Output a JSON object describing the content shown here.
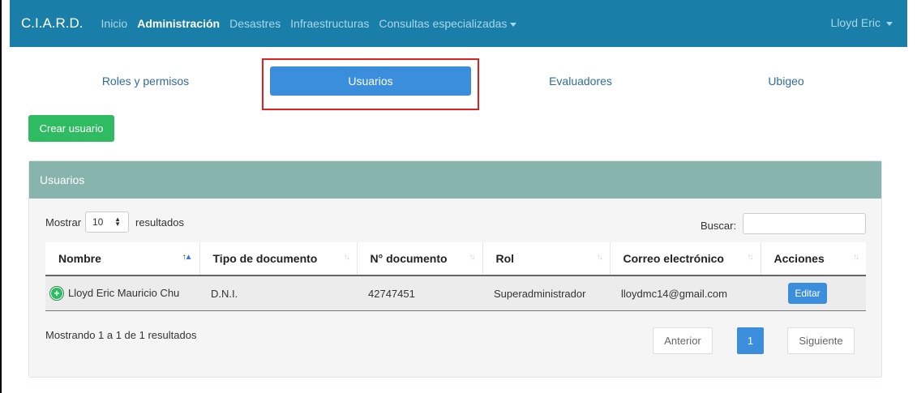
{
  "navbar": {
    "brand": "C.I.A.R.D.",
    "links": [
      "Inicio",
      "Administración",
      "Desastres",
      "Infraestructuras",
      "Consultas especializadas"
    ],
    "user": "Lloyd Eric"
  },
  "tabs": [
    "Roles y permisos",
    "Usuarios",
    "Evaluadores",
    "Ubigeo"
  ],
  "create_button": "Crear usuario",
  "panel": {
    "title": "Usuarios",
    "show_label": "Mostrar",
    "show_value": "10",
    "results_label": "resultados",
    "search_label": "Buscar:"
  },
  "table": {
    "headers": [
      "Nombre",
      "Tipo de documento",
      "N° documento",
      "Rol",
      "Correo electrónico",
      "Acciones"
    ],
    "rows": [
      {
        "nombre": "Lloyd Eric Mauricio Chu",
        "tipo_documento": "D.N.I.",
        "numero_documento": "42747451",
        "rol": "Superadministrador",
        "correo": "lloydmc14@gmail.com",
        "accion": "Editar"
      }
    ]
  },
  "pagination": {
    "info": "Mostrando 1 a 1 de 1 resultados",
    "previous": "Anterior",
    "current": "1",
    "next": "Siguiente"
  },
  "colors": {
    "navbar": "#1a7fa8",
    "active_tab": "#3a8edc",
    "create_button": "#2fbb62",
    "panel_header": "#87b4ad",
    "highlight": "#e0201f"
  }
}
